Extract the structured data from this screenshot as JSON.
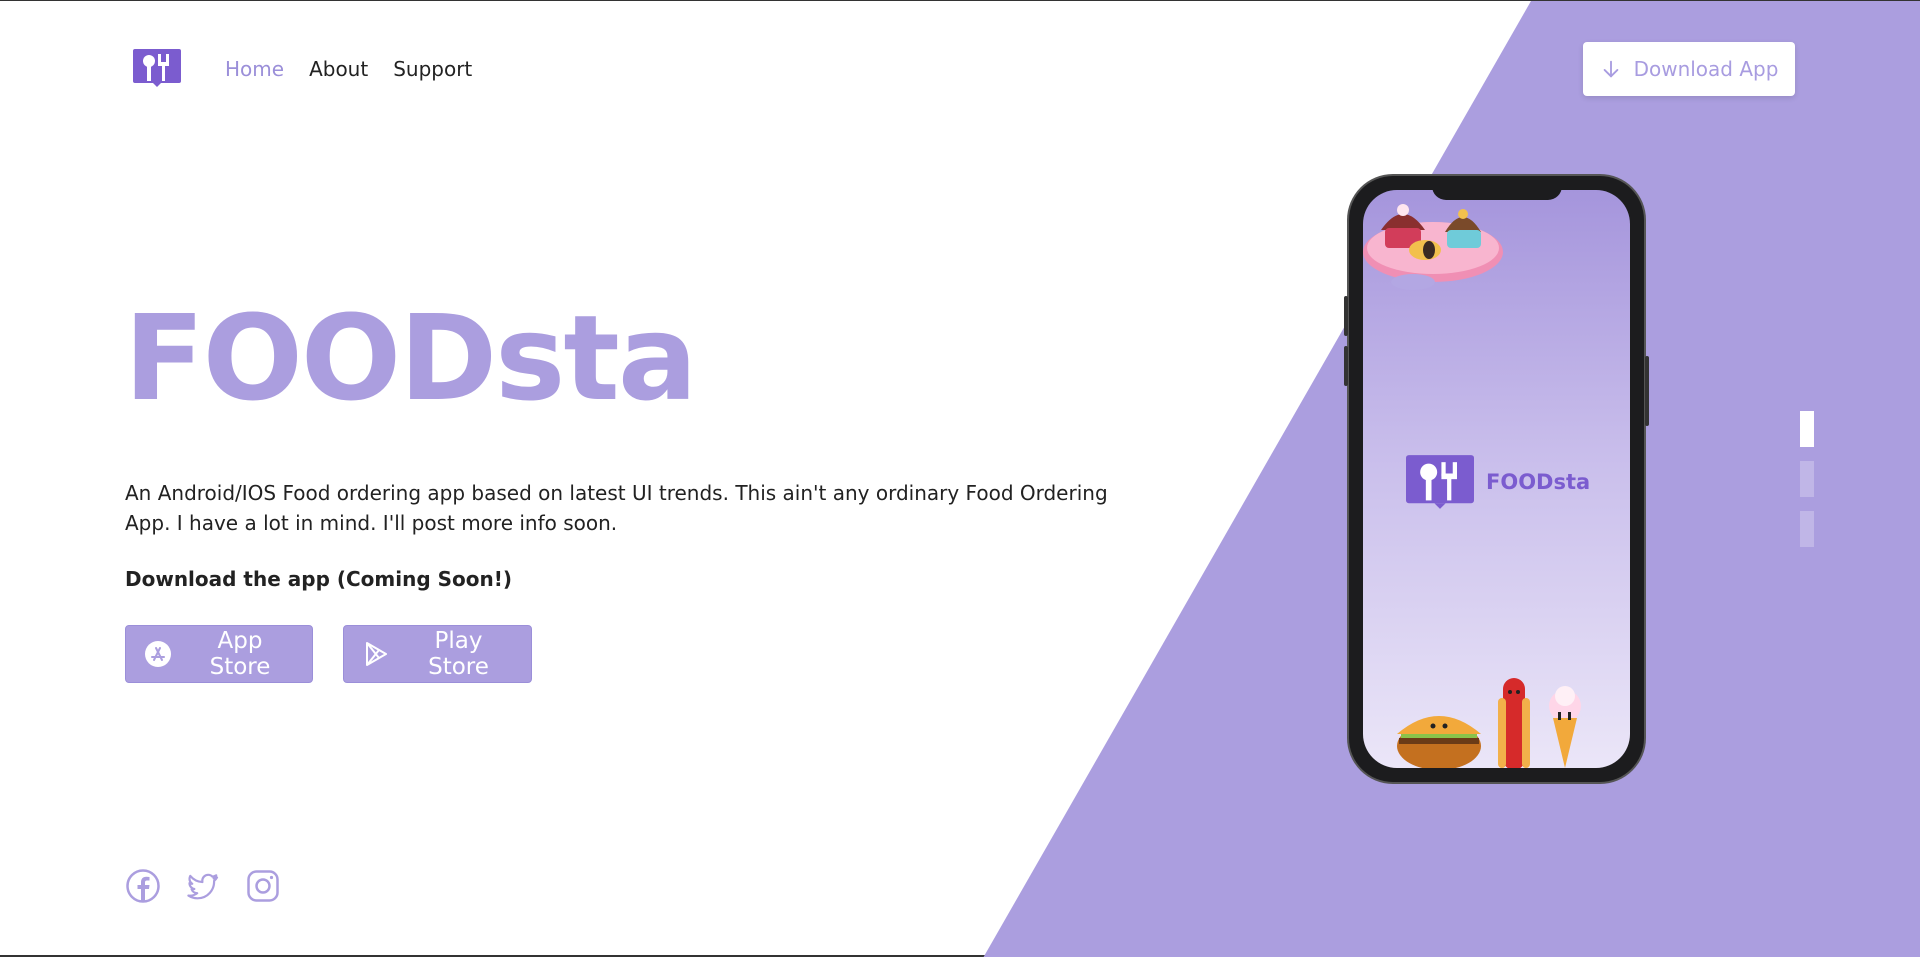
{
  "nav": {
    "items": [
      {
        "label": "Home",
        "active": true
      },
      {
        "label": "About",
        "active": false
      },
      {
        "label": "Support",
        "active": false
      }
    ]
  },
  "header": {
    "download_label": "Download App",
    "download_icon": "arrow-down-icon"
  },
  "hero": {
    "title": "FOODsta",
    "description": "An Android/IOS Food ordering app based on latest UI trends. This ain't any ordinary Food Ordering App. I have a lot in mind. I'll post more info soon.",
    "download_label": "Download the app (Coming Soon!)"
  },
  "stores": [
    {
      "label": "App Store",
      "icon": "app-store-icon"
    },
    {
      "label": "Play Store",
      "icon": "play-store-icon"
    }
  ],
  "social": [
    "facebook-icon",
    "twitter-icon",
    "instagram-icon"
  ],
  "phone": {
    "brand_name": "FOODsta"
  },
  "slider": {
    "count": 3,
    "active_index": 0
  },
  "colors": {
    "accent": "#ab9edf",
    "accent_dark": "#7b5ccf",
    "text": "#222222",
    "background": "#ffffff"
  }
}
